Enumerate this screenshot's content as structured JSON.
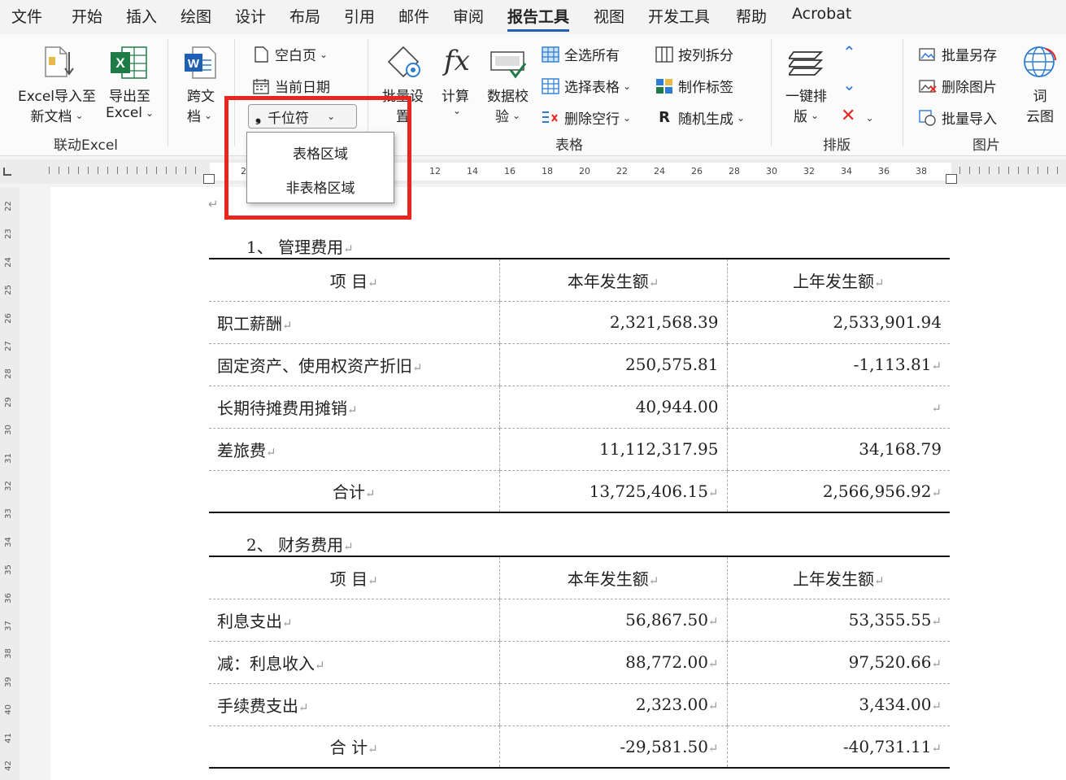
{
  "menu_tabs": [
    "文件",
    "开始",
    "插入",
    "绘图",
    "设计",
    "布局",
    "引用",
    "邮件",
    "审阅",
    "报告工具",
    "视图",
    "开发工具",
    "帮助",
    "Acrobat"
  ],
  "active_tab": "报告工具",
  "ribbon": {
    "excel_import": [
      "Excel导入至",
      "新文档"
    ],
    "excel_export": [
      "导出至",
      "Excel"
    ],
    "cross_doc": [
      "跨文",
      "档"
    ],
    "blank_page": "空白页",
    "current_date": "当前日期",
    "thousands_sep": "千位符",
    "batch_settings": [
      "批量设",
      "置"
    ],
    "calc": "计算",
    "data_check": [
      "数据校",
      "验"
    ],
    "select_all": "全选所有",
    "select_table": "选择表格",
    "delete_empty_rows": "删除空行",
    "split_by_column": "按列拆分",
    "make_label": "制作标签",
    "random_generate": "随机生成",
    "one_click_layout": [
      "一键排",
      "版"
    ],
    "batch_save_as": "批量另存",
    "delete_images": "删除图片",
    "batch_import": "批量导入",
    "word_cloud": [
      "词",
      "云图"
    ],
    "groups": {
      "linked_excel": "联动Excel",
      "table": "表格",
      "layout": "排版",
      "image": "图片"
    }
  },
  "dropdown": {
    "items": [
      "表格区域",
      "非表格区域"
    ]
  },
  "ruler_numbers": [
    "2",
    "12",
    "14",
    "16",
    "18",
    "20",
    "22",
    "24",
    "26",
    "28",
    "30",
    "32",
    "34",
    "36",
    "38"
  ],
  "vruler_numbers": [
    "22",
    "23",
    "24",
    "25",
    "26",
    "27",
    "28",
    "29",
    "30",
    "31",
    "32",
    "33",
    "34",
    "35",
    "36",
    "37",
    "38",
    "39",
    "40",
    "41",
    "42"
  ],
  "doc": {
    "section1": {
      "heading": "1、  管理费用",
      "header": [
        "项      目",
        "本年发生额",
        "上年发生额"
      ],
      "rows": [
        {
          "item": "职工薪酬",
          "current": "2,321,568.39",
          "prior": "2,533,901.94"
        },
        {
          "item": "固定资产、使用权资产折旧",
          "current": "250,575.81",
          "prior": "-1,113.81"
        },
        {
          "item": "长期待摊费用摊销",
          "current": "40,944.00",
          "prior": ""
        },
        {
          "item": "差旅费",
          "current": "11,112,317.95",
          "prior": "34,168.79"
        }
      ],
      "total": {
        "item": "合计",
        "current": "13,725,406.15",
        "prior": "2,566,956.92"
      }
    },
    "section2": {
      "heading": "2、  财务费用",
      "header": [
        "项      目",
        "本年发生额",
        "上年发生额"
      ],
      "rows": [
        {
          "item": "利息支出",
          "current": "56,867.50",
          "prior": "53,355.55"
        },
        {
          "item": "减：利息收入",
          "current": "88,772.00",
          "prior": "97,520.66"
        },
        {
          "item": "手续费支出",
          "current": "2,323.00",
          "prior": "3,434.00"
        }
      ],
      "total": {
        "item": "合    计",
        "current": "-29,581.50",
        "prior": "-40,731.11"
      }
    },
    "para_mark": "↵"
  },
  "colors": {
    "highlight": "#e8261d",
    "excel_green": "#1e7b45",
    "word_blue": "#1f5fb4",
    "accent_blue": "#2b7cd3"
  }
}
